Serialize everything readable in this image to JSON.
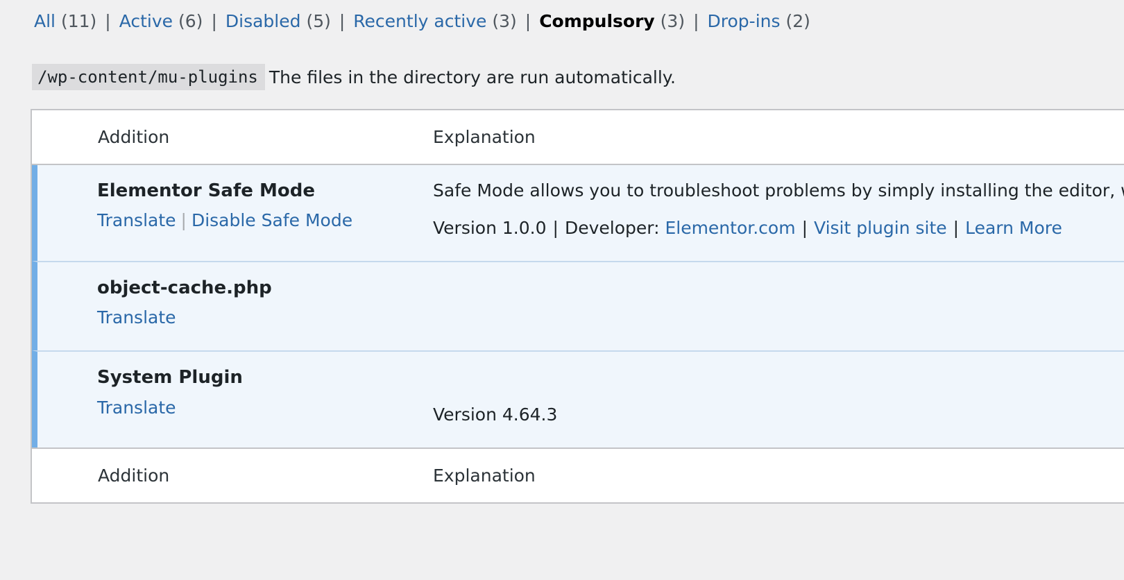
{
  "filters": [
    {
      "label": "All",
      "count": "(11)",
      "current": false
    },
    {
      "label": "Active",
      "count": "(6)",
      "current": false
    },
    {
      "label": "Disabled",
      "count": "(5)",
      "current": false
    },
    {
      "label": "Recently active",
      "count": "(3)",
      "current": false
    },
    {
      "label": "Compulsory",
      "count": "(3)",
      "current": true
    },
    {
      "label": "Drop-ins",
      "count": "(2)",
      "current": false
    }
  ],
  "filter_separator": "|",
  "directory": {
    "path": "/wp-content/mu-plugins",
    "note": "The files in the directory are run automatically."
  },
  "table": {
    "header": {
      "col_plugin": "Addition",
      "col_description": "Explanation"
    },
    "footer": {
      "col_plugin": "Addition",
      "col_description": "Explanation"
    },
    "rows": [
      {
        "name": "Elementor Safe Mode",
        "actions": [
          "Translate",
          "Disable Safe Mode"
        ],
        "description": "Safe Mode allows you to troubleshoot problems by simply installing the editor, with",
        "version": "Version 1.0.0",
        "developer_label": "Developer:",
        "developer_link": "Elementor.com",
        "links": [
          "Visit plugin site",
          "Learn More"
        ]
      },
      {
        "name": "object-cache.php",
        "actions": [
          "Translate"
        ]
      },
      {
        "name": "System Plugin",
        "actions": [
          "Translate"
        ],
        "version": "Version 4.64.3"
      }
    ]
  },
  "colors": {
    "link": "#2a68a8",
    "row_accent": "#72aee6",
    "row_background": "#f0f6fc",
    "page_background": "#f0f0f1"
  }
}
